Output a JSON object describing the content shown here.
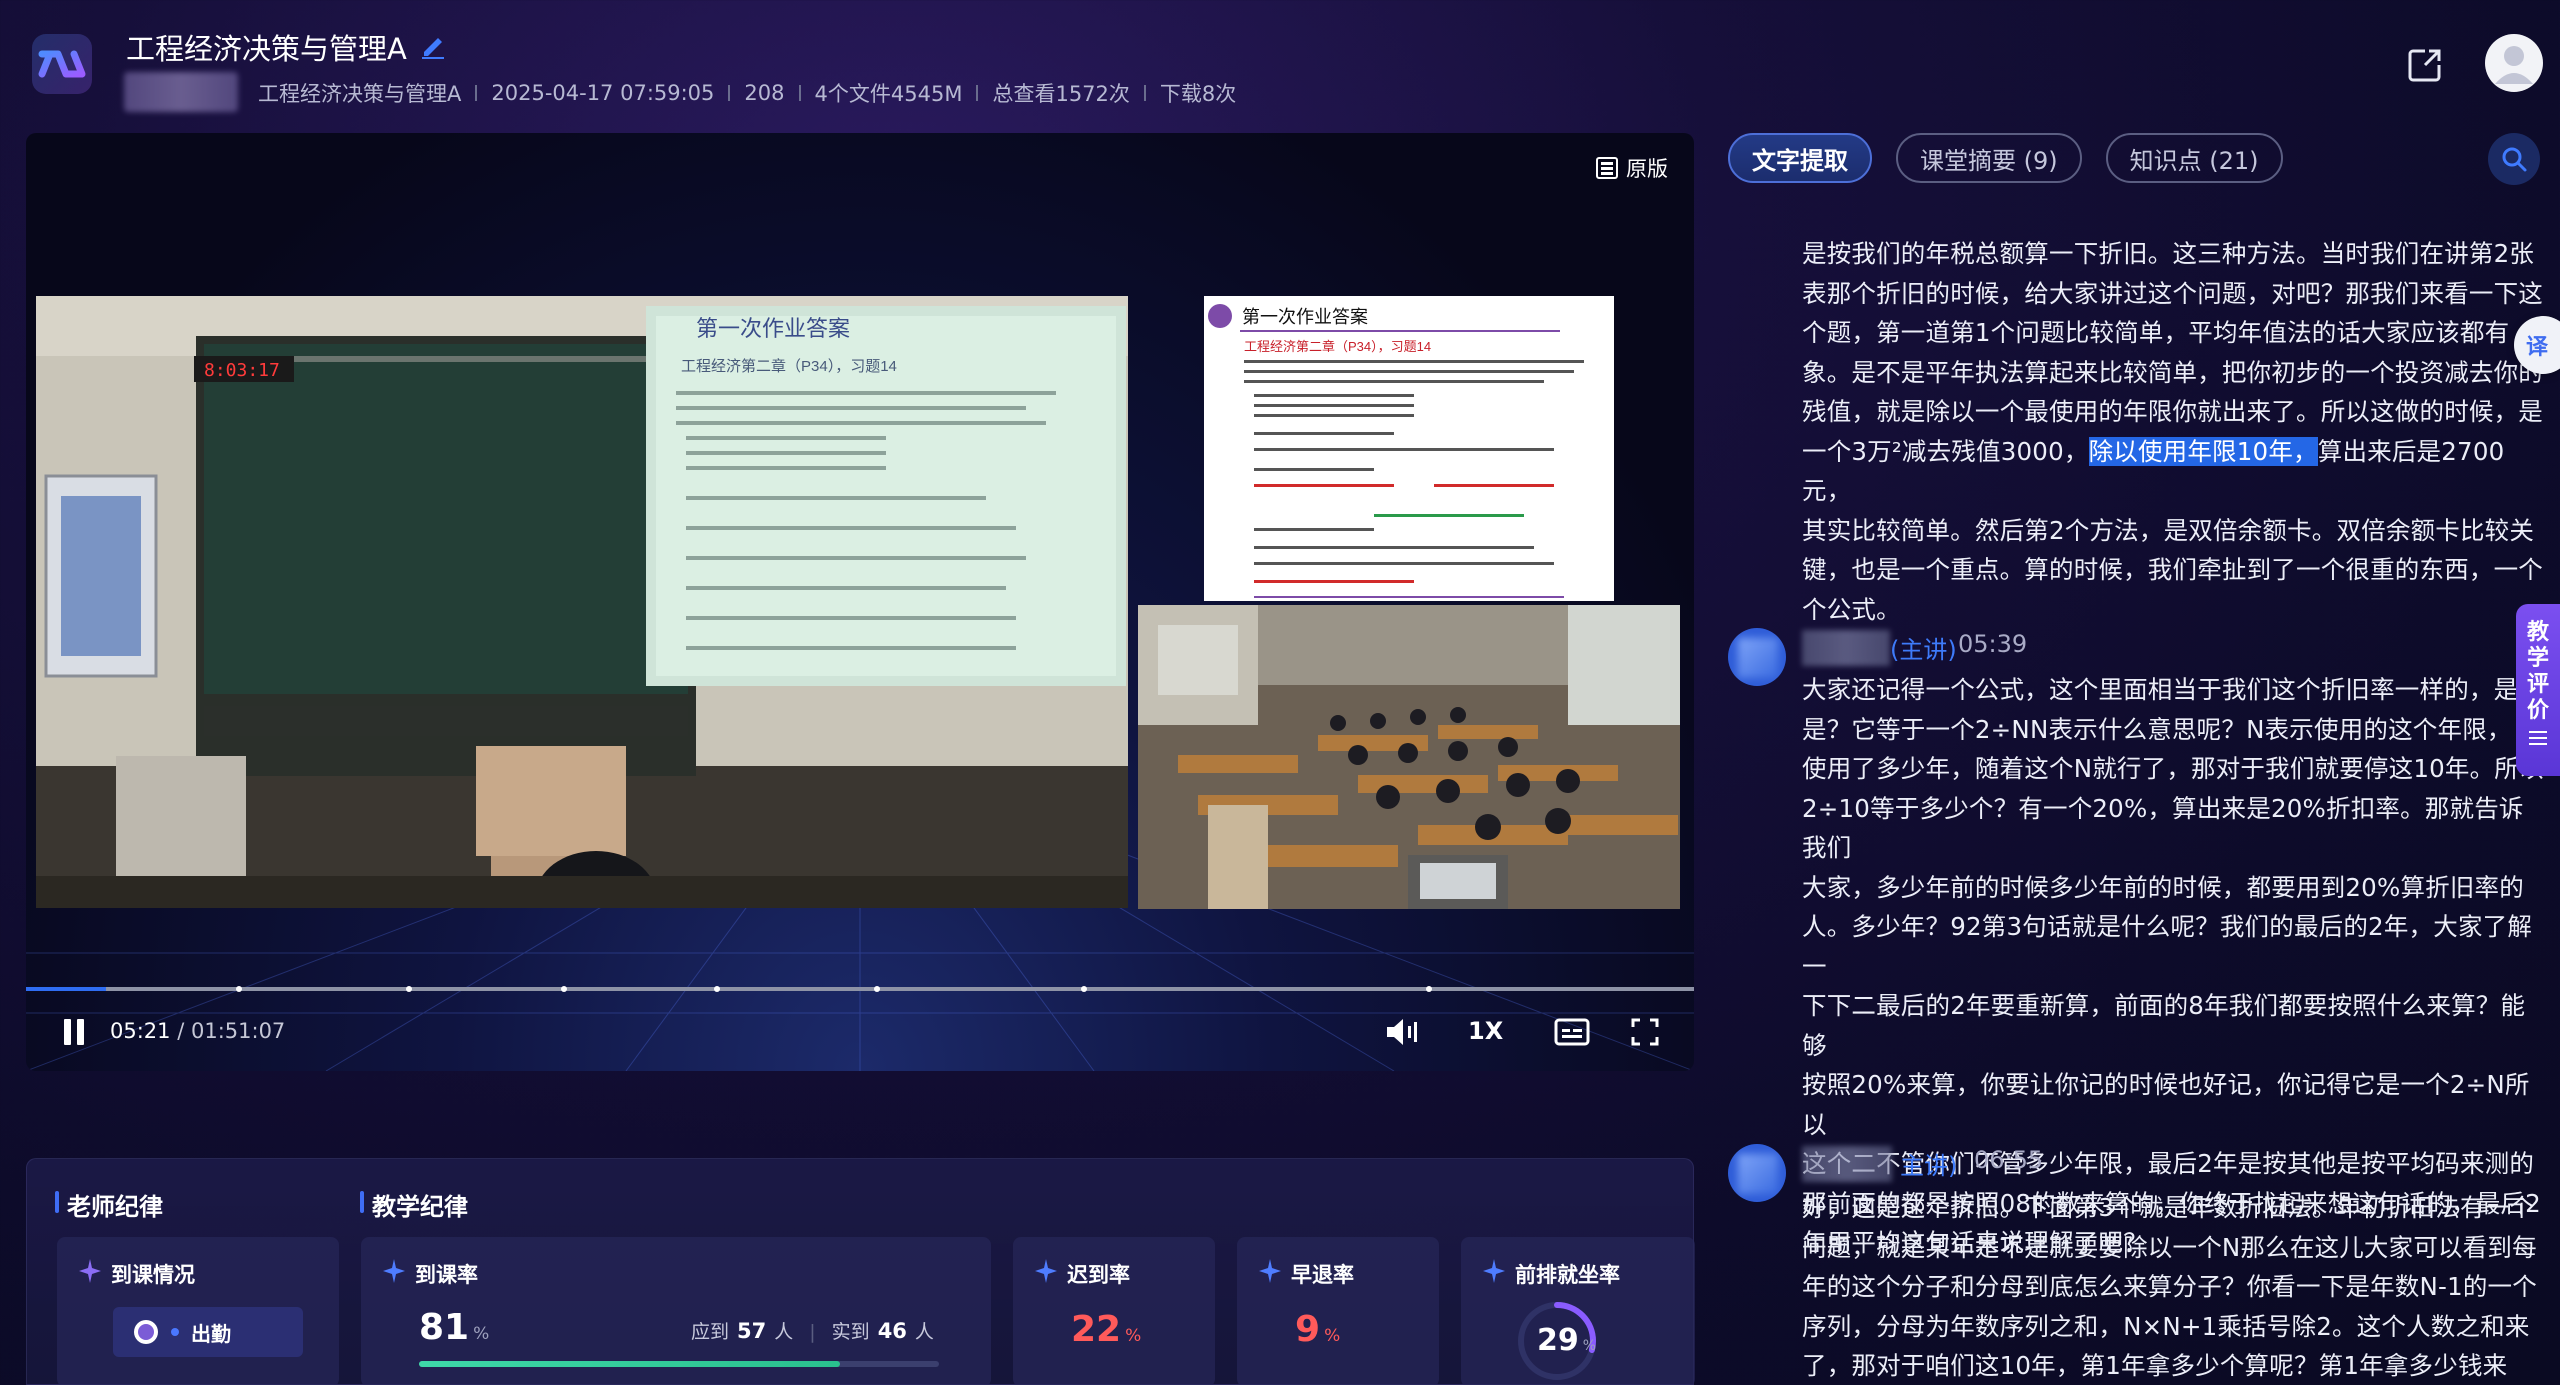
{
  "header": {
    "title": "工程经济决策与管理A",
    "meta": [
      "工程经济决策与管理A",
      "2025-04-17 07:59:05",
      "208",
      "4个文件4545M",
      "总查看1572次",
      "下载8次"
    ]
  },
  "video": {
    "original_label": "原版",
    "current_time": "05:21",
    "total_time": "/ 01:51:07",
    "progress": 0.048,
    "speed_label": "1X",
    "clock": "8:03:17",
    "slide_title": "第一次作业答案",
    "slide_subtitle": "工程经济第二章（P34），习题14"
  },
  "stats": {
    "teacher_title": "老师纪律",
    "teaching_title": "教学纪律",
    "attendance_card": {
      "title": "到课情况",
      "status": "出勤"
    },
    "arrival_rate": {
      "title": "到课率",
      "value": "81",
      "unit": "%",
      "expected_label": "应到",
      "expected": "57",
      "actual_label": "实到",
      "actual": "46",
      "person_unit": "人",
      "fraction": 0.81
    },
    "late_rate": {
      "title": "迟到率",
      "value": "22",
      "unit": "%"
    },
    "leave_rate": {
      "title": "早退率",
      "value": "9",
      "unit": "%"
    },
    "front_rate": {
      "title": "前排就坐率",
      "value": "29",
      "unit": "%",
      "fraction": 0.29
    }
  },
  "tabs": [
    {
      "label": "文字提取",
      "active": true
    },
    {
      "label": "课堂摘要 (9)",
      "active": false
    },
    {
      "label": "知识点 (21)",
      "active": false
    }
  ],
  "transcript": {
    "block1_lines": [
      "是按我们的年税总额算一下折旧。这三种方法。当时我们在讲第2张",
      "表那个折旧的时候，给大家讲过这个问题，对吧？那我们来看一下这",
      "个题，第一道第1个问题比较简单，平均年值法的话大家应该都有",
      "象。是不是平年执法算起来比较简单，把你初步的一个投资减去你的",
      "残值，就是除以一个最使用的年限你就出来了。所以这做的时候，是"
    ],
    "block1_line6_pre": "一个3万²减去残值3000，",
    "block1_highlight": "除以使用年限10年，",
    "block1_line6_post": "算出来后是2700元，",
    "block1_lines_after": [
      "其实比较简单。然后第2个方法，是双倍余额卡。双倍余额卡比较关",
      "键，也是一个重点。算的时候，我们牵扯到了一个很重的东西，一个",
      "个公式。"
    ],
    "speaker2": {
      "role": "(主讲)",
      "time": "05:39"
    },
    "block2_lines": [
      "大家还记得一个公式，这个里面相当于我们这个折旧率一样的，是不",
      "是？它等于一个2÷NN表示什么意思呢？N表示使用的这个年限，",
      "使用了多少年，随着这个N就行了，那对于我们就要停这10年。所以",
      "2÷10等于多少个？有一个20%，算出来是20%折扣率。那就告诉我们",
      "大家，多少年前的时候多少年前的时候，都要用到20%算折旧率的",
      "人。多少年？92第3句话就是什么呢？我们的最后的2年，大家了解一",
      "下下二最后的2年要重新算，前面的8年我们都要按照什么来算？能够",
      "按照20%来算，你要让你记的时候也好记，你记得它是一个2÷N所以",
      "这个二不管你们不管多少年限，最后2年是按其他是按平均码来测的",
      "那前面的都是按照08的数来算的，你终于找起来想这句话的，最后2",
      "年用平均这句话来说理解了吧？"
    ],
    "speaker3": {
      "role": "主讲)",
      "time": "06:55"
    },
    "block3_lines": [
      "好，这是这个折旧。下面第3个就是年数折旧法。年初折旧法有一个",
      "问题，就是某年是不是就要要除以一个N那么在这儿大家可以看到每",
      "年的这个分子和分母到底怎么来算分子？你看一下是年数N-1的一个",
      "序列，分母为年数序列之和，N×N+1乘括号除2。这个人数之和来",
      "了，那对于咱们这10年，第1年拿多少个算呢？第1年拿多少钱来算？"
    ]
  },
  "side": {
    "translate_label": "译",
    "eval_label": "教学评价"
  }
}
